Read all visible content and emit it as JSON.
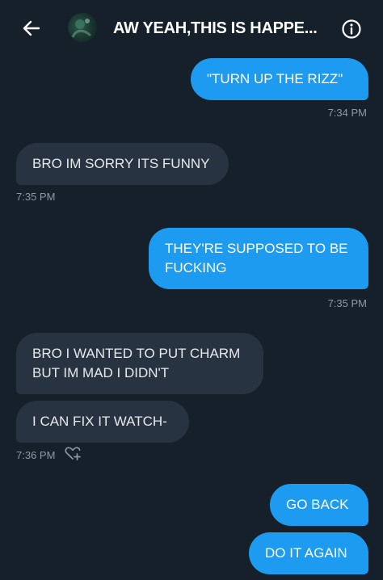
{
  "header": {
    "title": "AW YEAH,THIS IS HAPPE...",
    "back_icon": "arrow-left-icon",
    "info_icon": "info-circle-icon"
  },
  "colors": {
    "background": "#15202b",
    "sent_bubble": "#1d9bf0",
    "received_bubble": "#273340",
    "timestamp": "#8b98a5"
  },
  "messages": [
    {
      "direction": "sent",
      "text": "\"TURN UP THE RIZZ\""
    },
    {
      "direction": "received",
      "text": "BRO IM SORRY ITS FUNNY"
    },
    {
      "direction": "sent",
      "text": "THEY'RE SUPPOSED TO BE\nFUCKING"
    },
    {
      "direction": "received",
      "text": "BRO I WANTED TO PUT CHARM\nBUT IM MAD I DIDN'T"
    },
    {
      "direction": "received",
      "text": "I CAN FIX IT WATCH-"
    },
    {
      "direction": "sent",
      "text": "GO BACK"
    },
    {
      "direction": "sent",
      "text": "DO IT AGAIN"
    }
  ],
  "timestamps": [
    "7:34 PM",
    "7:35 PM",
    "7:35 PM",
    "7:36 PM"
  ],
  "reaction_icon": "heart-plus-icon"
}
